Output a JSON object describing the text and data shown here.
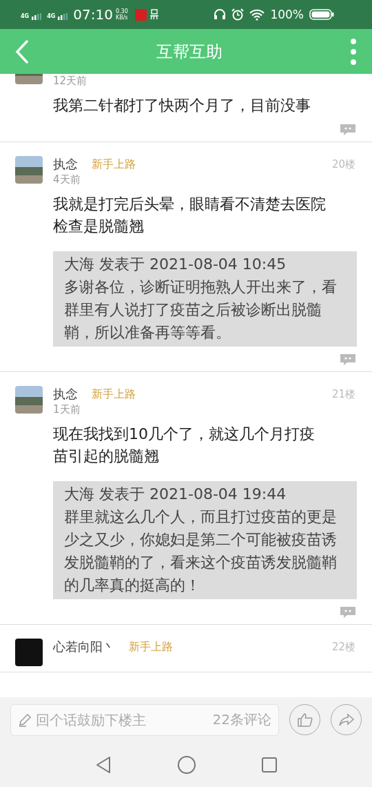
{
  "status_bar": {
    "network_1": "4G",
    "network_2": "4G",
    "time": "07:10",
    "speed_value": "0.30",
    "speed_unit": "KB/s",
    "battery": "100%"
  },
  "header": {
    "title": "互帮互助"
  },
  "posts": [
    {
      "time": "12天前",
      "body": "我第二针都打了快两个月了，目前没事"
    },
    {
      "name": "执念",
      "badge": "新手上路",
      "floor": "20楼",
      "time": "4天前",
      "body": "我就是打完后头晕，眼睛看不清楚去医院检查是脱髓翘",
      "quote": {
        "meta": "大海 发表于 2021-08-04 10:45",
        "text": "多谢各位，诊断证明拖熟人开出来了，看群里有人说打了疫苗之后被诊断出脱髓鞘，所以准备再等等看。"
      }
    },
    {
      "name": "执念",
      "badge": "新手上路",
      "floor": "21楼",
      "time": "1天前",
      "body": "现在我找到10几个了，就这几个月打疫苗引起的脱髓翘",
      "quote": {
        "meta": "大海 发表于 2021-08-04 19:44",
        "text": "群里就这么几个人，而且打过疫苗的更是少之又少，你媳妇是第二个可能被疫苗诱发脱髓鞘的了，看来这个疫苗诱发脱髓鞘的几率真的挺高的！"
      }
    },
    {
      "name": "心若向阳丶",
      "badge": "新手上路",
      "floor": "22楼"
    }
  ],
  "comment_bar": {
    "placeholder": "回个话鼓励下楼主",
    "count": "22条评论"
  }
}
